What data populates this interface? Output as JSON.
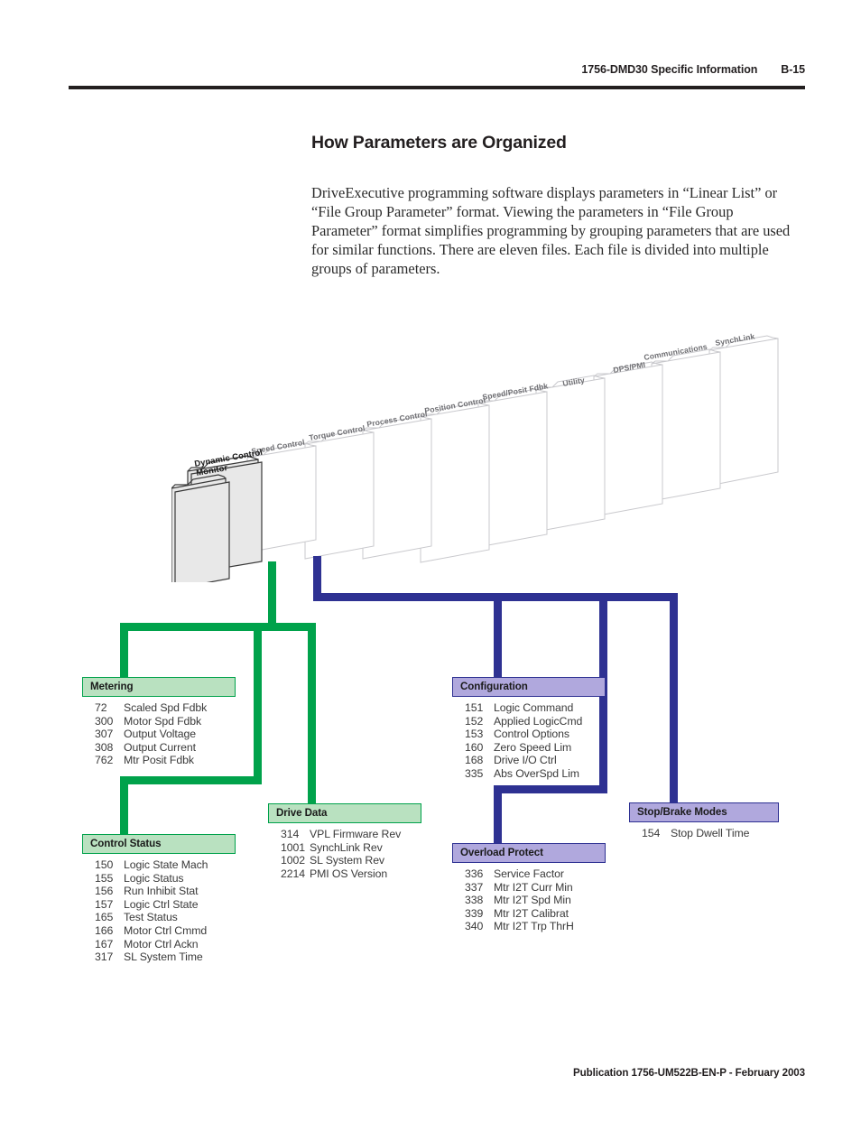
{
  "header": {
    "chapter_title": "1756-DMD30 Specific Information",
    "page_number": "B-15"
  },
  "section": {
    "title": "How Parameters are Organized",
    "body": "DriveExecutive programming software displays parameters in “Linear List” or “File Group Parameter” format.  Viewing the parameters in “File Group Parameter” format simplifies programming by grouping parameters that are used for similar functions.  There are eleven files. Each file is divided into multiple groups of parameters."
  },
  "footer": {
    "publication": "Publication 1756-UM522B-EN-P - February 2003"
  },
  "diagram": {
    "folders": [
      {
        "label": "Monitor",
        "style": "front"
      },
      {
        "label": "Dynamic Control",
        "style": "front"
      },
      {
        "label": "Speed Control",
        "style": "back"
      },
      {
        "label": "Torque Control",
        "style": "back"
      },
      {
        "label": "Process Control",
        "style": "back"
      },
      {
        "label": "Position Control",
        "style": "back"
      },
      {
        "label": "Speed/Posit Fdbk",
        "style": "back"
      },
      {
        "label": "Utility",
        "style": "back"
      },
      {
        "label": "DPS/PMI",
        "style": "back"
      },
      {
        "label": "Communications",
        "style": "back"
      },
      {
        "label": "SynchLink",
        "style": "back"
      }
    ],
    "colors": {
      "monitor_branch": "#00a24b",
      "dynamic_branch": "#2e3192",
      "green_header_fill": "#b9e1c0",
      "blue_header_fill": "#b0a8dd"
    },
    "groups": [
      {
        "id": "metering",
        "title": "Metering",
        "branch": "monitor",
        "parameters": [
          {
            "num": "72",
            "name": "Scaled Spd Fdbk"
          },
          {
            "num": "300",
            "name": "Motor Spd Fdbk"
          },
          {
            "num": "307",
            "name": "Output Voltage"
          },
          {
            "num": "308",
            "name": "Output Current"
          },
          {
            "num": "762",
            "name": "Mtr Posit Fdbk"
          }
        ]
      },
      {
        "id": "control-status",
        "title": "Control Status",
        "branch": "monitor",
        "parameters": [
          {
            "num": "150",
            "name": "Logic State Mach"
          },
          {
            "num": "155",
            "name": "Logic Status"
          },
          {
            "num": "156",
            "name": "Run Inhibit Stat"
          },
          {
            "num": "157",
            "name": "Logic Ctrl State"
          },
          {
            "num": "165",
            "name": "Test Status"
          },
          {
            "num": "166",
            "name": "Motor Ctrl Cmmd"
          },
          {
            "num": "167",
            "name": "Motor Ctrl Ackn"
          },
          {
            "num": "317",
            "name": "SL System Time"
          }
        ]
      },
      {
        "id": "drive-data",
        "title": "Drive Data",
        "branch": "monitor",
        "parameters": [
          {
            "num": "314",
            "name": "VPL Firmware Rev"
          },
          {
            "num": "1001",
            "name": "SynchLink Rev"
          },
          {
            "num": "1002",
            "name": "SL System Rev"
          },
          {
            "num": "2214",
            "name": "PMI OS Version"
          }
        ]
      },
      {
        "id": "configuration",
        "title": "Configuration",
        "branch": "dynamic",
        "parameters": [
          {
            "num": "151",
            "name": "Logic Command"
          },
          {
            "num": "152",
            "name": "Applied LogicCmd"
          },
          {
            "num": "153",
            "name": "Control Options"
          },
          {
            "num": "160",
            "name": "Zero Speed Lim"
          },
          {
            "num": "168",
            "name": "Drive I/O Ctrl"
          },
          {
            "num": "335",
            "name": "Abs OverSpd Lim"
          }
        ]
      },
      {
        "id": "overload-protect",
        "title": "Overload Protect",
        "branch": "dynamic",
        "parameters": [
          {
            "num": "336",
            "name": "Service Factor"
          },
          {
            "num": "337",
            "name": "Mtr I2T Curr Min"
          },
          {
            "num": "338",
            "name": "Mtr I2T Spd Min"
          },
          {
            "num": "339",
            "name": "Mtr I2T Calibrat"
          },
          {
            "num": "340",
            "name": "Mtr I2T Trp ThrH"
          }
        ]
      },
      {
        "id": "stop-brake-modes",
        "title": "Stop/Brake Modes",
        "branch": "dynamic",
        "parameters": [
          {
            "num": "154",
            "name": "Stop Dwell Time"
          }
        ]
      }
    ]
  }
}
